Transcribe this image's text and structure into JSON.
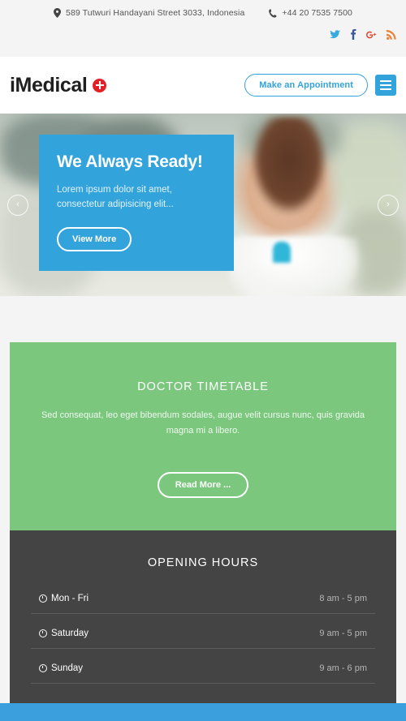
{
  "topbar": {
    "address": "589 Tutwuri Handayani Street 3033, Indonesia",
    "phone": "+44 20 7535 7500",
    "address_icon": "map-pin-icon",
    "phone_icon": "phone-icon",
    "socials": [
      {
        "name": "twitter",
        "glyph": "ᵗ",
        "color": "#3aa9e0"
      },
      {
        "name": "facebook",
        "glyph": "f",
        "color": "#3b5998"
      },
      {
        "name": "googleplus",
        "glyph": "8⁺",
        "color": "#dd4b39"
      },
      {
        "name": "rss",
        "glyph": "≋",
        "color": "#e8833a"
      }
    ]
  },
  "header": {
    "logo_text": "iMedical",
    "logo_icon": "medical-cross-icon",
    "appointment_label": "Make an Appointment",
    "menu_icon": "hamburger-menu-icon"
  },
  "hero": {
    "title": "We Always Ready!",
    "description": "Lorem ipsum dolor sit amet, consectetur adipisicing elit...",
    "button_label": "View More",
    "prev_glyph": "‹",
    "next_glyph": "›"
  },
  "timetable": {
    "title": "DOCTOR TIMETABLE",
    "description": "Sed consequat, leo eget bibendum sodales, augue velit cursus nunc, quis gravida magna mi a libero.",
    "button_label": "Read More ...",
    "bg_color": "#7ac77d"
  },
  "opening_hours": {
    "title": "OPENING HOURS",
    "bg_color": "#444444",
    "rows": [
      {
        "day": "Mon - Fri",
        "time": "8 am - 5 pm"
      },
      {
        "day": "Saturday",
        "time": "9 am - 5 pm"
      },
      {
        "day": "Sunday",
        "time": "9 am - 6 pm"
      }
    ]
  },
  "theme": {
    "accent_blue": "#33a3dc",
    "accent_green": "#7ac77d",
    "accent_red": "#e12127",
    "dark": "#444444",
    "page_bg": "#f4f4f4"
  }
}
